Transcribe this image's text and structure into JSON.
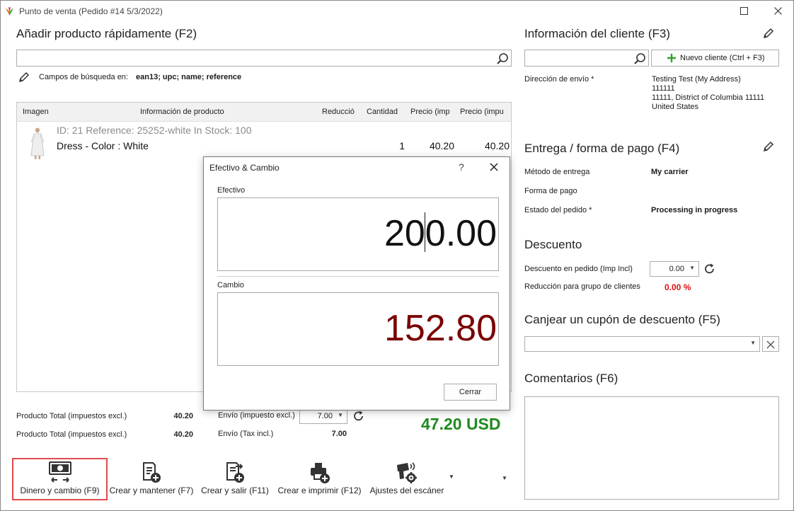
{
  "window": {
    "title": "Punto de venta (Pedido #14 5/3/2022)"
  },
  "quick_add": {
    "title": "Añadir producto rápidamente (F2)",
    "search_value": "",
    "search_fields_label": "Campos de búsqueda en:",
    "search_fields_value": "ean13; upc; name; reference"
  },
  "grid": {
    "headers": [
      "Imagen",
      "Información de producto",
      "Reducció",
      "Cantidad",
      "Precio (imp",
      "Precio (impu"
    ],
    "rows": [
      {
        "meta": "ID: 21 Reference: 25252-white In Stock: 100",
        "name": "Dress - Color : White",
        "quantity": "1",
        "price1": "40.20",
        "price2": "40.20"
      }
    ]
  },
  "dialog": {
    "title": "Efectivo & Cambio",
    "help": "?",
    "efectivo_label": "Efectivo",
    "efectivo_value": "200.00",
    "cambio_label": "Cambio",
    "cambio_value": "152.80",
    "close_label": "Cerrar"
  },
  "totals": {
    "product_total_excl_label": "Producto Total (impuestos excl.)",
    "product_total_excl_value": "40.20",
    "product_total_incl_label": "Producto Total (impuestos excl.)",
    "product_total_incl_value": "40.20",
    "shipping_excl_label": "Envío (impuesto excl.)",
    "shipping_excl_value": "7.00",
    "shipping_incl_label": "Envío (Tax incl.)",
    "shipping_incl_value": "7.00",
    "grand_total": "47.20 USD"
  },
  "toolbar": {
    "items": [
      {
        "label": "Dinero y cambio (F9)"
      },
      {
        "label": "Crear y mantener (F7)"
      },
      {
        "label": "Crear y salir (F11)"
      },
      {
        "label": "Crear e imprimir (F12)"
      },
      {
        "label": "Ajustes del escáner"
      }
    ]
  },
  "customer": {
    "title": "Información del cliente (F3)",
    "search_value": "",
    "new_customer_label": "Nuevo cliente (Ctrl + F3)",
    "shipping_address_label": "Dirección de envío *",
    "address_lines": [
      "Testing Test (My Address)",
      "111111",
      "11111, District of Columbia 11111",
      "United States"
    ]
  },
  "delivery": {
    "title": "Entrega / forma de pago (F4)",
    "method_label": "Método de entrega",
    "method_value": "My carrier",
    "payment_label": "Forma de pago",
    "payment_value": "",
    "status_label": "Estado del pedido *",
    "status_value": "Processing in progress"
  },
  "discount": {
    "title": "Descuento",
    "order_discount_label": "Descuento en pedido (Imp Incl)",
    "order_discount_value": "0.00",
    "group_reduction_label": "Reducción para grupo de clientes",
    "group_reduction_value": "0.00 %"
  },
  "coupon": {
    "title": "Canjear un cupón de descuento (F5)",
    "value": ""
  },
  "comments": {
    "title": "Comentarios (F6)",
    "value": ""
  },
  "colors": {
    "grand_total": "#1e8a1e",
    "cambio": "#7a0000",
    "group_reduction": "#e01010",
    "highlight": "#e04b4b",
    "add_icon": "#2aa52a"
  }
}
